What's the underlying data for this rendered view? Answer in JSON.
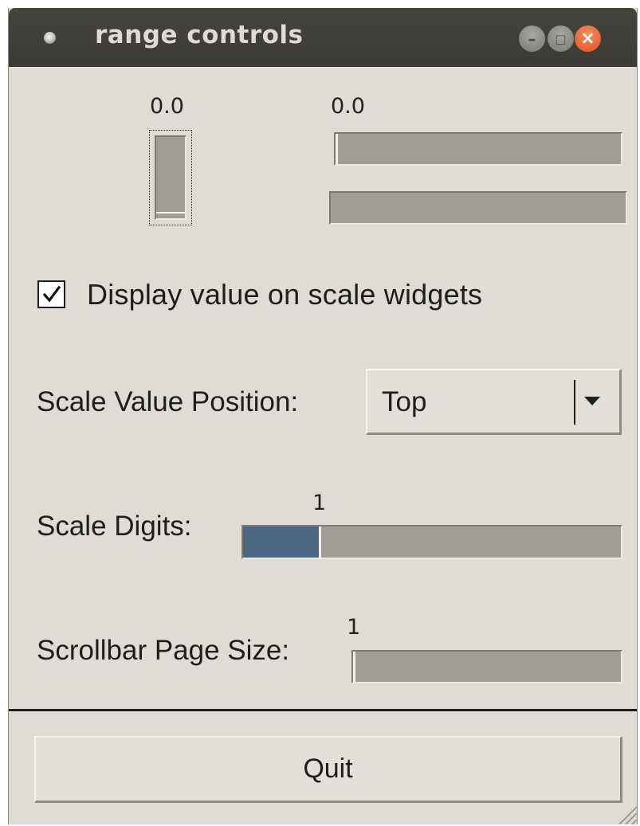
{
  "window": {
    "title": "range controls"
  },
  "scales": {
    "vertical": {
      "value_label": "0.0",
      "value": 0.0
    },
    "horizontal": {
      "value_label": "0.0",
      "value": 0.0
    },
    "scrollbar": {
      "value": 0.0
    }
  },
  "display_value": {
    "label": "Display value on scale widgets",
    "checked": true
  },
  "position": {
    "label": "Scale Value Position:",
    "selected": "Top"
  },
  "digits": {
    "label": "Scale Digits:",
    "value_label": "1",
    "fill_fraction": 0.2
  },
  "page_size": {
    "label": "Scrollbar Page Size:",
    "value_label": "1",
    "fill_fraction": 0.0
  },
  "footer": {
    "quit_label": "Quit"
  },
  "colors": {
    "titlebar": "#3f3e3a",
    "window_bg": "#dfdcd6",
    "trough": "#a09d97",
    "slider_fill": "#4a6783",
    "close_button": "#e8602a"
  },
  "icons": {
    "app": "app-dot-icon",
    "minimize": "minimize-icon",
    "maximize": "maximize-icon",
    "close": "close-icon",
    "check": "checkmark-icon",
    "dropdown": "dropdown-arrow-icon",
    "resize": "resize-grip-icon"
  }
}
